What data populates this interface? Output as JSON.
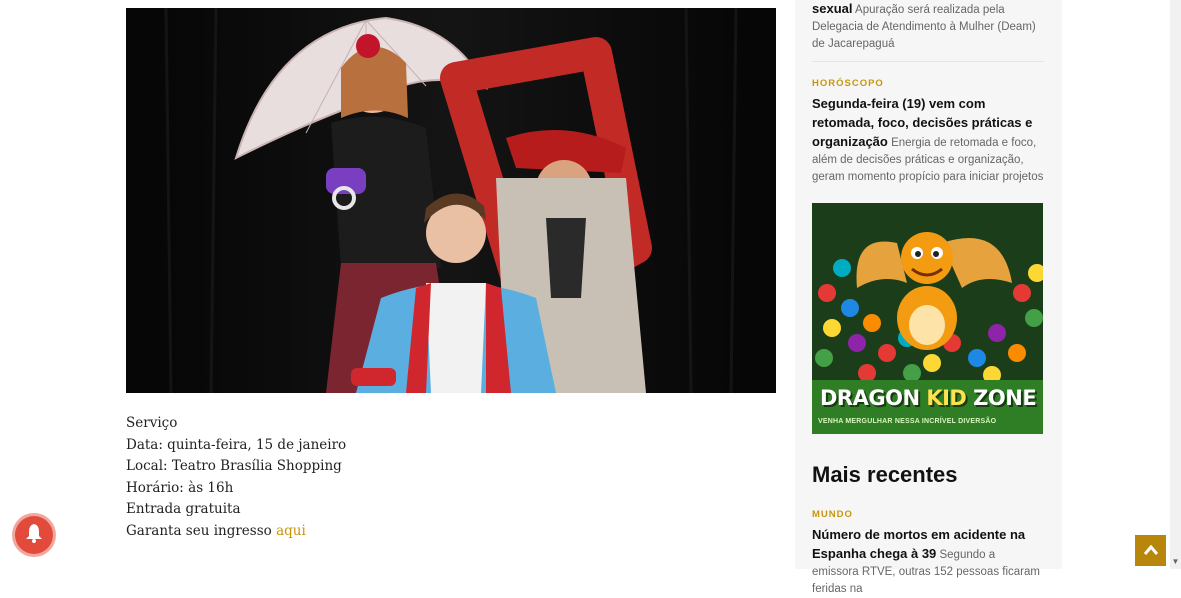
{
  "article": {
    "photo_alt": "",
    "service": {
      "heading": "Serviço",
      "date": "Data: quinta-feira, 15 de janeiro",
      "place": "Local: Teatro Brasília Shopping",
      "time": "Horário: às 16h",
      "entry": "Entrada gratuita",
      "ticket_prefix": "Garanta seu ingresso",
      "ticket_link": "aqui"
    }
  },
  "sidebar": {
    "top_item": {
      "title_end": "sexual",
      "summary": "Apuração será realizada pela Delegacia de Atendimento à Mulher (Deam) de Jacarepaguá"
    },
    "horoscope_item": {
      "kicker": "HORÓSCOPO",
      "title": "Segunda-feira (19) vem com retomada, foco, decisões práticas e organização",
      "summary": "Energia de retomada e foco, além de decisões práticas e organização, geram momento propício para iniciar projetos"
    },
    "ad": {
      "title_part1": "DRAGON ",
      "title_part2": "KID",
      "title_part3": " ZONE",
      "subtitle": "VENHA MERGULHAR NESSA INCRÍVEL DIVERSÃO"
    },
    "recent_heading": "Mais recentes",
    "recent_item": {
      "kicker": "MUNDO",
      "title": "Número de mortos em acidente na Espanha chega à 39",
      "summary": "Segundo a emissora RTVE, outras 152 pessoas ficaram feridas na"
    }
  },
  "icons": {
    "notification": "bell-icon",
    "back_to_top": "chevron-up-icon"
  },
  "colors": {
    "accent": "#c8960c",
    "notification_red": "#e24a3b",
    "back_to_top": "#b8860b"
  }
}
